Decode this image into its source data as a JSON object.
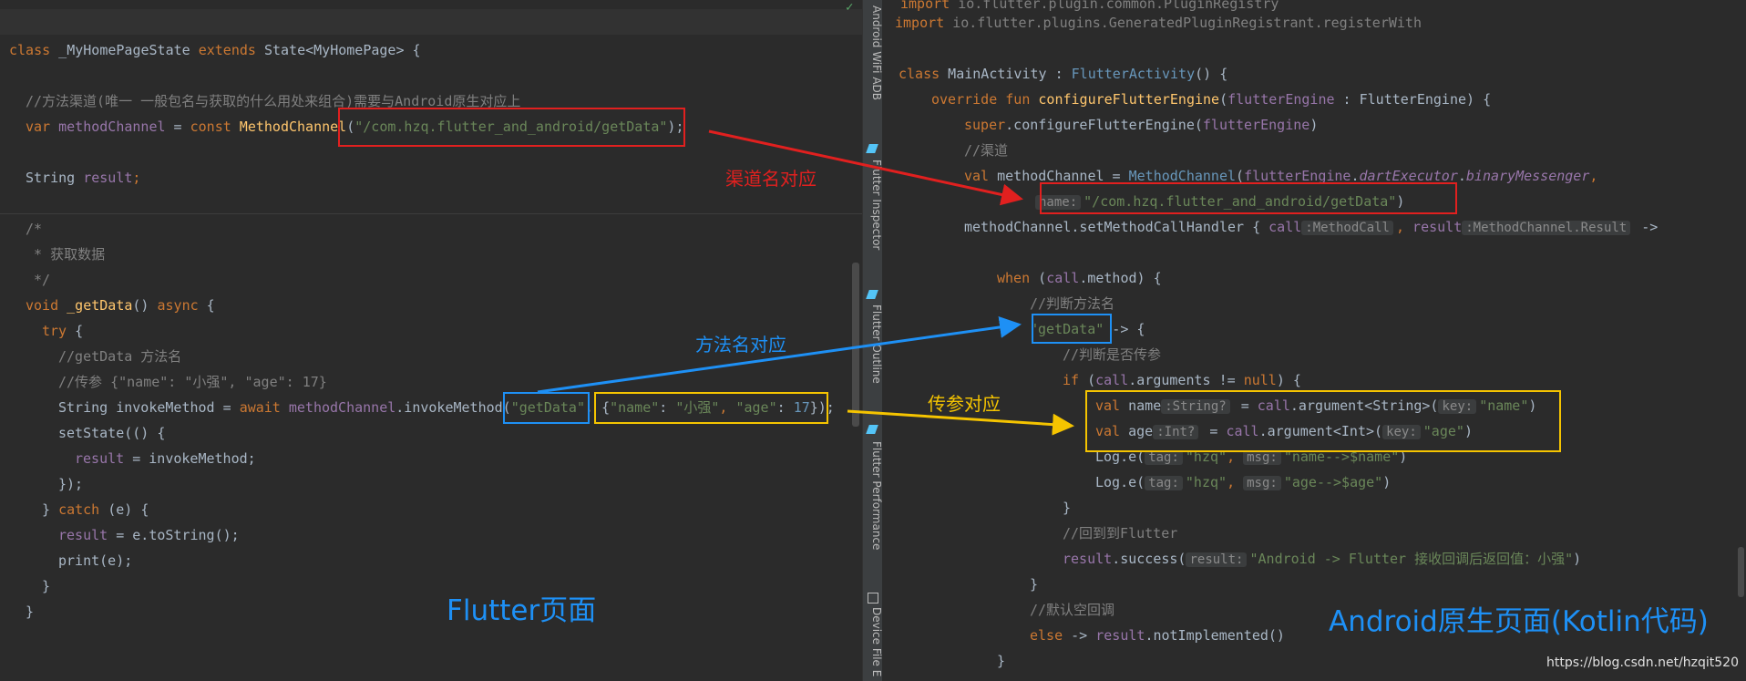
{
  "left": {
    "lines": {
      "l0": {
        "kw1": "class",
        "name": " _MyHomePageState ",
        "kw2": "extends",
        "rest": " State<MyHomePage> {"
      },
      "l1": {
        "comment": "//方法渠道(唯一 一般包名与获取的什么用处来组合)需要与Android原生对应上"
      },
      "l2": {
        "kw1": "var",
        "field": " methodChannel",
        "op": " = ",
        "kw2": "const",
        "fn": " MethodChannel",
        "p1": "(",
        "str": "\"/com.hzq.flutter_and_android/getData\"",
        "p2": ");"
      },
      "l3": {
        "type": "String",
        "field": " result",
        "end": ";"
      },
      "l4": {
        "comment": "/*"
      },
      "l5": {
        "comment": " * 获取数据"
      },
      "l6": {
        "comment": " */"
      },
      "l7": {
        "kw1": "void",
        "fn": " _getData",
        "p1": "() ",
        "kw2": "async",
        "p2": " {"
      },
      "l8": {
        "kw": "try",
        "p": " {"
      },
      "l9": {
        "comment": "//getData 方法名"
      },
      "l10": {
        "comment": "//传参 {\"name\": \"小强\", \"age\": 17}"
      },
      "l11": {
        "type": "String",
        "plain1": " invokeMethod = ",
        "kw": "await",
        "field": " methodChannel",
        "plain2": ".invokeMethod(",
        "str1": "\"getData\"",
        "comma": ", ",
        "brace1": "{",
        "k1": "\"name\"",
        "c1": ": ",
        "v1": "\"小强\"",
        "sep": ", ",
        "k2": "\"age\"",
        "c2": ": ",
        "num": "17",
        "brace2": "});"
      },
      "l12": {
        "plain": "setState(() {"
      },
      "l13": {
        "field": "result",
        "plain": " = invokeMethod;"
      },
      "l14": {
        "plain": "});"
      },
      "l15": {
        "p1": "} ",
        "kw": "catch",
        "p2": " (e) {"
      },
      "l16": {
        "field": "result",
        "plain": " = e.toString();"
      },
      "l17": {
        "plain": "print(e);"
      },
      "l18": {
        "plain": "}"
      },
      "l19": {
        "plain": "}"
      }
    },
    "label": "Flutter页面"
  },
  "strip": {
    "tabs": [
      "Android WiFi ADB",
      "Flutter Inspector",
      "Flutter Outline",
      "Flutter Performance",
      "Device File E"
    ]
  },
  "right": {
    "lines": {
      "r0": {
        "kw": "import",
        "plain": " io.flutter.plugin.common.PluginRegistry"
      },
      "r1": {
        "kw": "import",
        "plain": " io.flutter.plugins.GeneratedPluginRegistrant.registerWith"
      },
      "r2": {
        "kw": "class",
        "plain1": " MainActivity : ",
        "type": "FlutterActivity",
        "plain2": "() {"
      },
      "r3": {
        "kw1": "override fun",
        "fn": " configureFlutterEngine",
        "p1": "(",
        "param": "flutterEngine",
        "p2": " : FlutterEngine) {"
      },
      "r4": {
        "kw": "super",
        "plain": ".configureFlutterEngine(",
        "param": "flutterEngine",
        "end": ")"
      },
      "r5": {
        "comment": "//渠道"
      },
      "r6": {
        "kw": "val",
        "plain1": " methodChannel = ",
        "type": "MethodChannel",
        "p1": "(",
        "param": "flutterEngine",
        "dot": ".",
        "f1": "dartExecutor",
        "dot2": ".",
        "f2": "binaryMessenger",
        "comma": ","
      },
      "r7": {
        "hint": "name:",
        "str": "\"/com.hzq.flutter_and_android/getData\"",
        "end": ")"
      },
      "r8": {
        "plain": "methodChannel.setMethodCallHandler { ",
        "param1": "call",
        "hint1": ":MethodCall",
        "comma": ", ",
        "param2": "result",
        "hint2": ":MethodChannel.Result",
        "arrow": " ->"
      },
      "r9": {
        "kw": "when",
        "p1": " (",
        "param": "call",
        "plain": ".method",
        "p2": ") {"
      },
      "r10": {
        "comment": "//判断方法名"
      },
      "r11": {
        "str": "\"getData\"",
        "plain": " -> {"
      },
      "r12": {
        "comment": "//判断是否传参"
      },
      "r13": {
        "kw": "if",
        "p1": " (",
        "param": "call",
        "plain": ".arguments != ",
        "kw2": "null",
        "p2": ") {"
      },
      "r14": {
        "kw": "val",
        "plain1": " name",
        "hint": ":String?",
        "plain2": " = ",
        "param": "call",
        "plain3": ".argument<String>(",
        "hint2": "key:",
        "str": "\"name\"",
        "end": ")"
      },
      "r15": {
        "kw": "val",
        "plain1": " age",
        "hint": ":Int?",
        "plain2": " = ",
        "param": "call",
        "plain3": ".argument<Int>(",
        "hint2": "key:",
        "str": "\"age\"",
        "end": ")"
      },
      "r16": {
        "plain1": "Log.e(",
        "hint1": "tag:",
        "str1": "\"hzq\"",
        "comma": ", ",
        "hint2": "msg:",
        "str2": "\"name-->$name\"",
        "end": ")"
      },
      "r17": {
        "plain1": "Log.e(",
        "hint1": "tag:",
        "str1": "\"hzq\"",
        "comma": ", ",
        "hint2": "msg:",
        "str2": "\"age-->$age\"",
        "end": ")"
      },
      "r18": {
        "plain": "}"
      },
      "r19": {
        "comment": "//回到到Flutter"
      },
      "r20": {
        "param": "result",
        "plain": ".success(",
        "hint": "result:",
        "str": "\"Android -> Flutter 接收回调后返回值：小强\"",
        "end": ")"
      },
      "r21": {
        "plain": "}"
      },
      "r22": {
        "comment": "//默认空回调"
      },
      "r23": {
        "kw": "else",
        "plain1": " -> ",
        "param": "result",
        "plain2": ".notImplemented()"
      },
      "r24": {
        "plain": "}"
      }
    },
    "label": "Android原生页面(Kotlin代码)"
  },
  "annotations": {
    "channel": "渠道名对应",
    "method": "方法名对应",
    "params": "传参对应"
  },
  "watermark": "https://blog.csdn.net/hzqit520",
  "colors": {
    "red": "#e1201f",
    "blue": "#1e90f5",
    "yellow": "#f5c400"
  }
}
